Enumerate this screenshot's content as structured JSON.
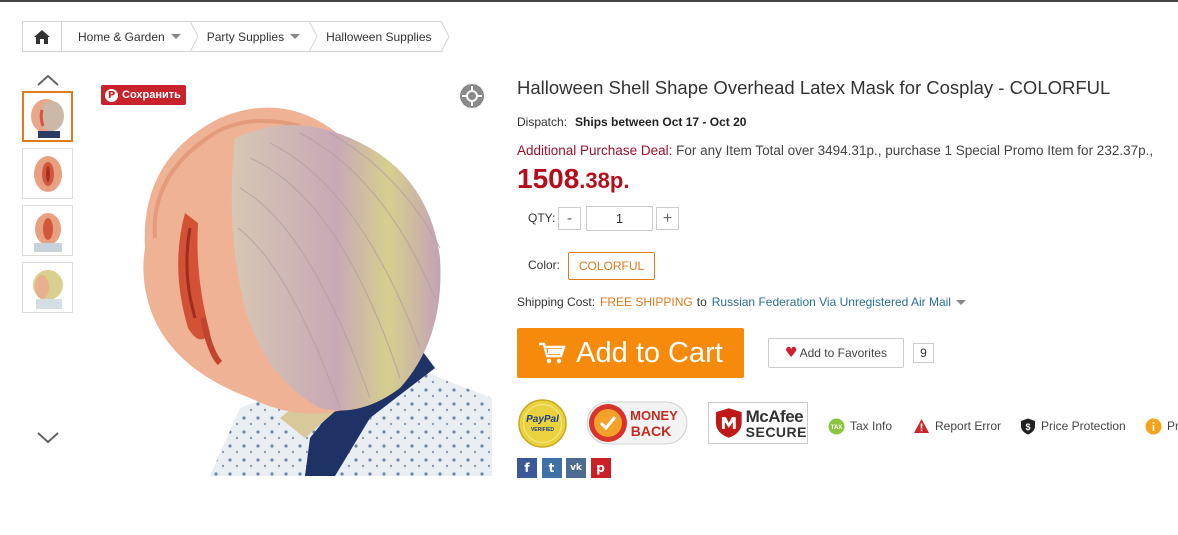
{
  "breadcrumb": {
    "home_icon": "home-icon",
    "items": [
      {
        "label": "Home & Garden"
      },
      {
        "label": "Party Supplies"
      },
      {
        "label": "Halloween Supplies"
      }
    ]
  },
  "gallery": {
    "up_icon": "chevron-up-icon",
    "down_icon": "chevron-down-icon",
    "thumbnail_count": 4,
    "active_index": 0
  },
  "image_overlay": {
    "save_label": "Сохранить",
    "zoom_icon": "zoom-icon"
  },
  "product": {
    "title": "Halloween Shell Shape Overhead Latex Mask for Cosplay  -  COLORFUL",
    "dispatch_label": "Dispatch:",
    "dispatch_value": "Ships between Oct 17 - Oct 20",
    "deal_label": "Additional Purchase Deal:",
    "deal_text": " For any Item Total over 3494.31p., purchase 1 Special Promo Item for 232.37p.,",
    "price_main": "1508",
    "price_fraction": ".38p.",
    "price_color": "#b40d1b"
  },
  "quantity": {
    "label": "QTY:",
    "minus": "-",
    "plus": "+",
    "value": "1"
  },
  "color": {
    "label": "Color:",
    "selected": "COLORFUL",
    "accent": "#e07a1c"
  },
  "shipping": {
    "label": "Shipping Cost:",
    "free": "FREE SHIPPING",
    "to": "to",
    "method": "Russian Federation Via Unregistered Air Mail"
  },
  "actions": {
    "add_to_cart": "Add to Cart",
    "cart_color": "#f58a0b",
    "add_to_favorites": "Add to Favorites",
    "favorites_count": "9"
  },
  "badges": {
    "paypal_line1": "PayPal",
    "paypal_line2": "VERIFIED",
    "money_back_line1": "MONEY",
    "money_back_line2": "BACK",
    "mcafee_line1": "McAfee",
    "mcafee_line2": "SECURE"
  },
  "services": [
    {
      "label": "Tax Info",
      "icon": "tax-icon"
    },
    {
      "label": "Report Error",
      "icon": "warning-icon"
    },
    {
      "label": "Price Protection",
      "icon": "shield-dollar-icon"
    },
    {
      "label": "Pr",
      "icon": "info-icon"
    }
  ],
  "social": [
    {
      "icon": "facebook-icon",
      "glyph": "f"
    },
    {
      "icon": "twitter-icon",
      "glyph": "t"
    },
    {
      "icon": "vk-icon",
      "glyph": "vk"
    },
    {
      "icon": "pinterest-icon",
      "glyph": "p"
    }
  ]
}
